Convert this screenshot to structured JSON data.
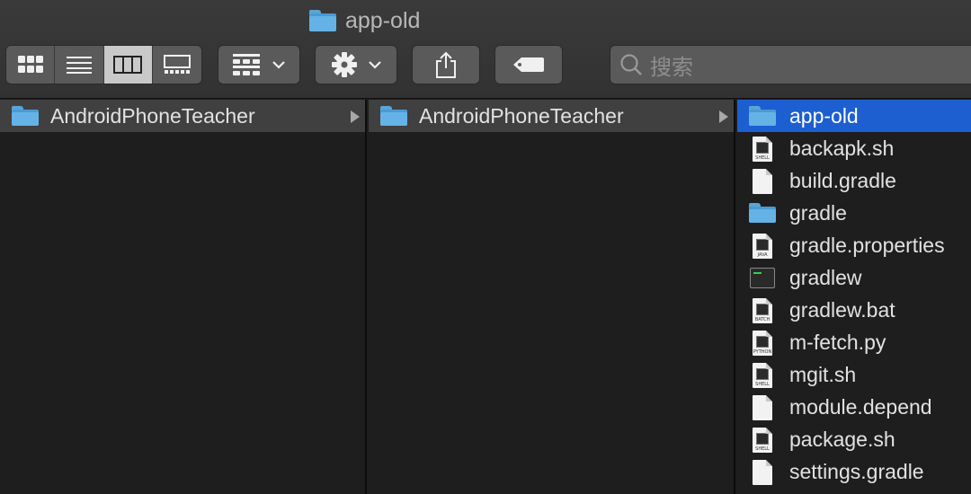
{
  "window": {
    "title": "app-old"
  },
  "toolbar": {
    "view_modes": [
      {
        "name": "icon-view-icon",
        "active": false
      },
      {
        "name": "list-view-icon",
        "active": false
      },
      {
        "name": "column-view-icon",
        "active": true
      },
      {
        "name": "gallery-view-icon",
        "active": false
      }
    ],
    "group_icon": "grid-group-icon",
    "action_icon": "gear-icon",
    "share_icon": "share-icon",
    "tag_icon": "tag-icon",
    "search": {
      "placeholder": "搜索",
      "icon": "search-icon"
    }
  },
  "columns": [
    {
      "items": [
        {
          "name": "AndroidPhoneTeacher",
          "type": "folder",
          "state": "path"
        }
      ]
    },
    {
      "items": [
        {
          "name": "AndroidPhoneTeacher",
          "type": "folder",
          "state": "path"
        }
      ]
    },
    {
      "items": [
        {
          "name": "app-old",
          "type": "folder",
          "state": "selected"
        },
        {
          "name": "backapk.sh",
          "type": "script",
          "badge": "SHELL"
        },
        {
          "name": "build.gradle",
          "type": "document"
        },
        {
          "name": "gradle",
          "type": "folder"
        },
        {
          "name": "gradle.properties",
          "type": "script",
          "badge": "JAVA"
        },
        {
          "name": "gradlew",
          "type": "executable"
        },
        {
          "name": "gradlew.bat",
          "type": "script",
          "badge": "BATCH"
        },
        {
          "name": "m-fetch.py",
          "type": "script",
          "badge": "PYTHON"
        },
        {
          "name": "mgit.sh",
          "type": "script",
          "badge": "SHELL"
        },
        {
          "name": "module.depend",
          "type": "document"
        },
        {
          "name": "package.sh",
          "type": "script",
          "badge": "SHELL"
        },
        {
          "name": "settings.gradle",
          "type": "document"
        }
      ]
    }
  ],
  "colors": {
    "selection": "#1d5fd1",
    "folder": "#65b3e6",
    "path_highlight": "#404040"
  }
}
